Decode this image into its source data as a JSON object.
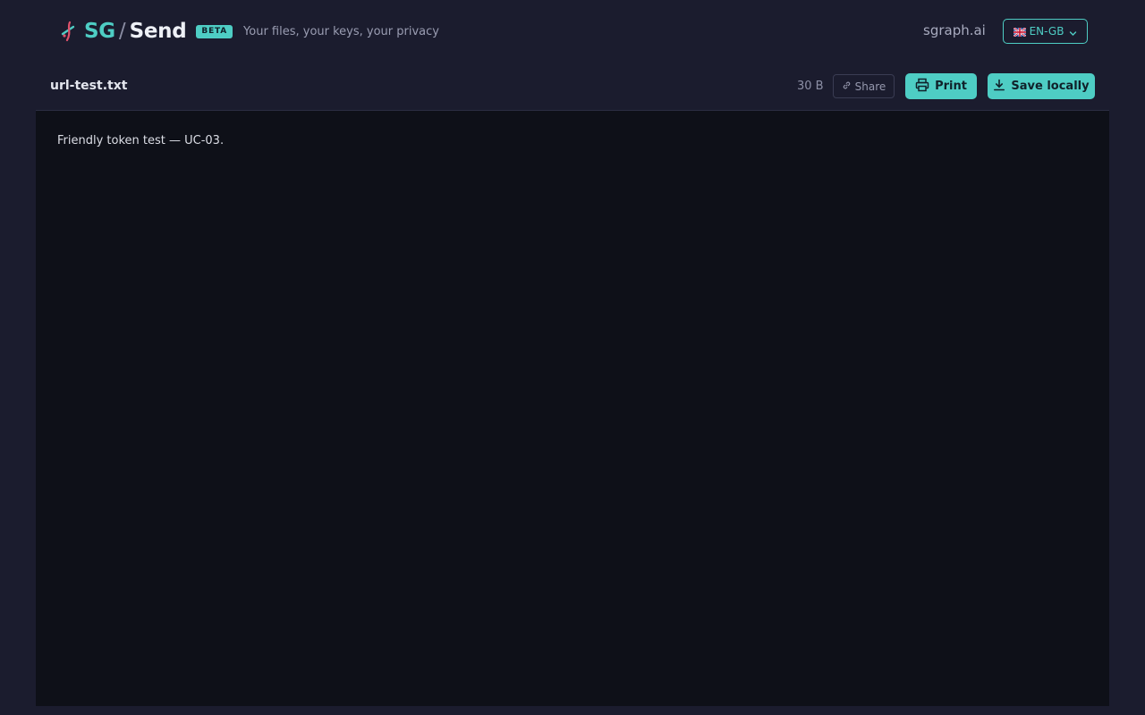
{
  "header": {
    "brand_sg": "SG",
    "brand_slash": "/",
    "brand_send": "Send",
    "beta_label": "BETA",
    "tagline": "Your files, your keys, your privacy",
    "site_link": "sgraph.ai",
    "language": {
      "flag_icon": "uk-flag-icon",
      "selected": "EN-GB"
    }
  },
  "file": {
    "name": "url-test.txt",
    "size": "30 B",
    "share_label": "Share",
    "print_label": "Print",
    "save_label": "Save locally"
  },
  "viewer": {
    "content": "Friendly token test — UC-03."
  },
  "colors": {
    "accent": "#4ecdc4",
    "background": "#1b1c2e",
    "viewer_background": "#0e1018"
  },
  "icons": {
    "brand": "sg-logo-icon",
    "share": "link-icon",
    "print": "printer-icon",
    "save": "download-icon",
    "dropdown": "chevron-down-icon"
  }
}
